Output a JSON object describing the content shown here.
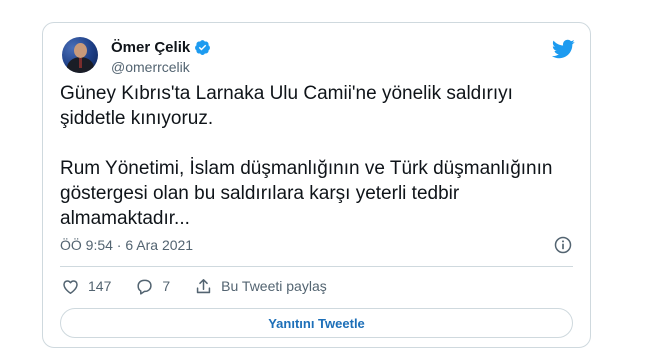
{
  "author": {
    "name": "Ömer Çelik",
    "handle": "@omerrcelik",
    "verified": true
  },
  "tweet": {
    "text": "Güney Kıbrıs'ta Larnaka Ulu Camii'ne yönelik saldırıyı\nşiddetle kınıyoruz.\n\nRum Yönetimi, İslam düşmanlığının ve Türk düşmanlığının\ngöstergesi olan bu saldırılara karşı yeterli tedbir\nalmamaktadır...",
    "timestamp": "ÖÖ 9:54 · 6 Ara 2021"
  },
  "actions": {
    "likes": "147",
    "replies": "7",
    "share_label": "Bu Tweeti paylaş"
  },
  "reply_button_label": "Yanıtını Tweetle",
  "colors": {
    "accent": "#1d9bf0",
    "text_secondary": "#536471",
    "border": "#cfd9de"
  },
  "icons": {
    "brand": "twitter-bird-icon",
    "verified": "verified-badge-icon",
    "info": "info-icon",
    "like": "heart-icon",
    "reply": "reply-bubble-icon",
    "share": "share-icon"
  }
}
